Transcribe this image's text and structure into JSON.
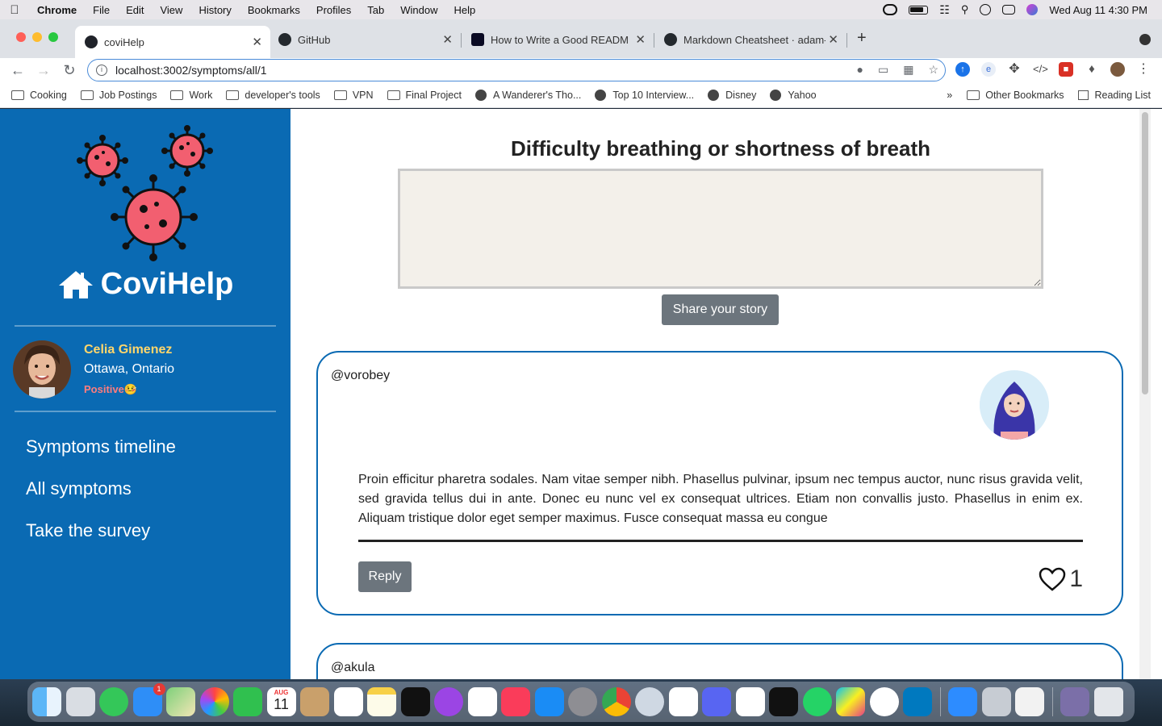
{
  "menubar": {
    "app": "Chrome",
    "items": [
      "File",
      "Edit",
      "View",
      "History",
      "Bookmarks",
      "Profiles",
      "Tab",
      "Window",
      "Help"
    ],
    "datetime": "Wed Aug 11  4:30 PM"
  },
  "tabs": [
    {
      "title": "coviHelp",
      "active": true
    },
    {
      "title": "GitHub",
      "active": false
    },
    {
      "title": "How to Write a Good README",
      "active": false
    },
    {
      "title": "Markdown Cheatsheet · adam-",
      "active": false
    }
  ],
  "address": {
    "url": "localhost:3002/symptoms/all/1"
  },
  "bookmarks": {
    "items": [
      "Cooking",
      "Job Postings",
      "Work",
      "developer's tools",
      "VPN",
      "Final Project",
      "A Wanderer's Tho...",
      "Top 10 Interview...",
      "Disney",
      "Yahoo"
    ],
    "overflow": "»",
    "other": "Other Bookmarks",
    "reading_list": "Reading List"
  },
  "sidebar": {
    "brand": "CoviHelp",
    "user": {
      "name": "Celia Gimenez",
      "location": "Ottawa, Ontario",
      "status": "Positive🤒"
    },
    "nav": [
      "Symptoms timeline",
      "All symptoms",
      "Take the survey"
    ]
  },
  "main": {
    "title": "Difficulty breathing or shortness of breath",
    "story_placeholder": "",
    "share_label": "Share your story",
    "posts": [
      {
        "handle": "@vorobey",
        "text": "Proin efficitur pharetra sodales. Nam vitae semper nibh. Phasellus pulvinar, ipsum nec tempus auctor, nunc risus gravida velit, sed gravida tellus dui in ante. Donec eu nunc vel ex consequat ultrices. Etiam non convallis justo. Phasellus in enim ex. Aliquam tristique dolor eget semper maximus. Fusce consequat massa eu congue",
        "reply_label": "Reply",
        "likes": "1"
      },
      {
        "handle": "@akula"
      }
    ]
  },
  "dock": {
    "calendar_month": "AUG",
    "calendar_day": "11",
    "mail_badge": "1"
  }
}
